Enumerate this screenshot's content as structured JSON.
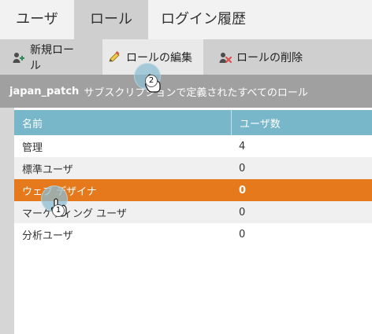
{
  "tabs": {
    "users": "ユーザ",
    "roles": "ロール",
    "login_history": "ログイン履歴"
  },
  "toolbar": {
    "new_role": "新規ロール",
    "edit_role": "ロールの編集",
    "delete_role": "ロールの削除"
  },
  "subheader": {
    "subscription": "japan_patch",
    "text": "サブスクリプションで定義されたすべてのロール"
  },
  "table": {
    "headers": {
      "name": "名前",
      "user_count": "ユーザ数"
    },
    "rows": [
      {
        "name": "管理",
        "count": "4"
      },
      {
        "name": "標準ユーザ",
        "count": "0"
      },
      {
        "name": "ウェブ デザイナ",
        "count": "0"
      },
      {
        "name": "マーケティング ユーザ",
        "count": "0"
      },
      {
        "name": "分析ユーザ",
        "count": "0"
      }
    ],
    "selected_index": 2
  },
  "cursors": {
    "step1": "1",
    "step2": "2"
  },
  "colors": {
    "tab_bg": "#f2f2f2",
    "tab_active_bg": "#cfcfcf",
    "toolbar_bg": "#cfcfcf",
    "subheader_bg": "#a0a0a0",
    "header_row_bg": "#77b7c9",
    "selected_row_bg": "#e6791c",
    "alt_row_bg": "#f0f0f0",
    "gutter_bg": "#d6d6d6"
  },
  "icons": {
    "new_role": "user-add-icon",
    "edit_role": "pencil-edit-icon",
    "delete_role": "user-delete-icon",
    "cursor": "hand-pointer-icon"
  }
}
